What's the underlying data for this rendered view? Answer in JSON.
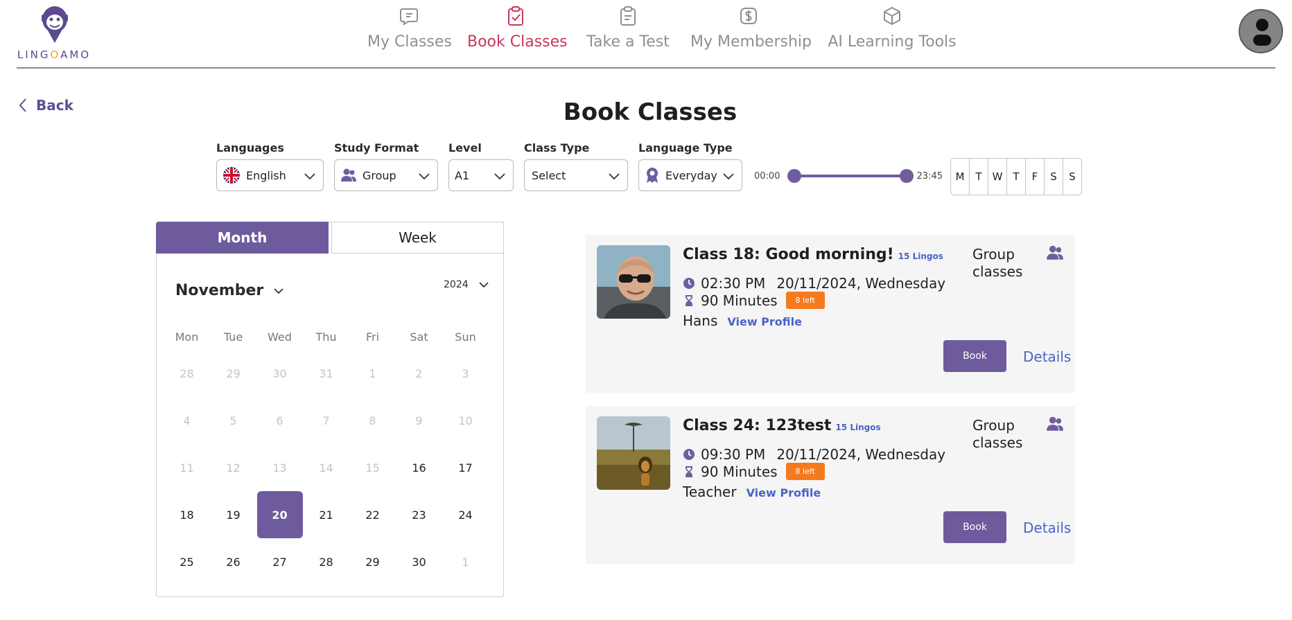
{
  "brand": {
    "logo_pre": "LING",
    "logo_o": "O",
    "logo_post": "AMO"
  },
  "nav": [
    {
      "label": "My Classes",
      "icon": "chat-icon"
    },
    {
      "label": "Book Classes",
      "icon": "clipboard-check-icon",
      "active": true
    },
    {
      "label": "Take a Test",
      "icon": "clipboard-icon"
    },
    {
      "label": "My Membership",
      "icon": "dollar-icon"
    },
    {
      "label": "AI Learning Tools",
      "icon": "cube-icon"
    }
  ],
  "back_label": "Back",
  "page_title": "Book Classes",
  "filters": {
    "languages": {
      "label": "Languages",
      "value": "English"
    },
    "study_format": {
      "label": "Study Format",
      "value": "Group"
    },
    "level": {
      "label": "Level",
      "value": "A1"
    },
    "class_type": {
      "label": "Class Type",
      "value": "Select"
    },
    "language_type": {
      "label": "Language Type",
      "value": "Everyday"
    },
    "time_start": "00:00",
    "time_end": "23:45",
    "days": [
      "M",
      "T",
      "W",
      "T",
      "F",
      "S",
      "S"
    ]
  },
  "calendar": {
    "tab_month": "Month",
    "tab_week": "Week",
    "month": "November",
    "year": "2024",
    "weekdays": [
      "Mon",
      "Tue",
      "Wed",
      "Thu",
      "Fri",
      "Sat",
      "Sun"
    ],
    "selected_day": "20",
    "weeks": [
      [
        "28",
        "29",
        "30",
        "31",
        "1",
        "2",
        "3"
      ],
      [
        "4",
        "5",
        "6",
        "7",
        "8",
        "9",
        "10"
      ],
      [
        "11",
        "12",
        "13",
        "14",
        "15",
        "16",
        "17"
      ],
      [
        "18",
        "19",
        "20",
        "21",
        "22",
        "23",
        "24"
      ],
      [
        "25",
        "26",
        "27",
        "28",
        "29",
        "30",
        "1"
      ]
    ]
  },
  "classes": [
    {
      "title": "Class 18: Good morning!",
      "lingos": "15 Lingos",
      "time": "02:30 PM",
      "date": "20/11/2024, Wednesday",
      "duration": "90 Minutes",
      "seats": "8 left",
      "teacher": "Hans",
      "view_profile": "View Profile",
      "type": "Group classes",
      "book": "Book",
      "details": "Details"
    },
    {
      "title": "Class 24: 123test",
      "lingos": "15 Lingos",
      "time": "09:30 PM",
      "date": "20/11/2024, Wednesday",
      "duration": "90 Minutes",
      "seats": "8 left",
      "teacher": "Teacher",
      "view_profile": "View Profile",
      "type": "Group classes",
      "book": "Book",
      "details": "Details"
    }
  ],
  "colors": {
    "accent": "#6d5b9d",
    "active_nav": "#c9355a",
    "link": "#4a63c8",
    "badge": "#f57a1e"
  }
}
